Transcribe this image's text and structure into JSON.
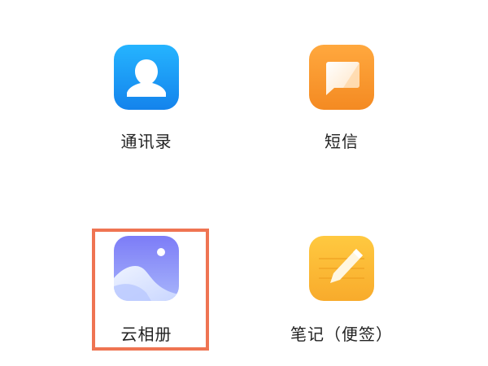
{
  "apps": [
    {
      "id": "contacts",
      "label": "通讯录",
      "icon": "contacts-icon"
    },
    {
      "id": "messages",
      "label": "短信",
      "icon": "message-icon"
    },
    {
      "id": "gallery",
      "label": "云相册",
      "icon": "gallery-icon"
    },
    {
      "id": "notes",
      "label": "笔记（便签）",
      "icon": "notes-icon"
    }
  ],
  "highlight": {
    "target": "gallery",
    "color": "#ef7452"
  },
  "colors": {
    "contacts_icon": "#1a9cf5",
    "messages_icon": "#f7962e",
    "gallery_icon": "#8c86f5",
    "notes_icon": "#fbb936"
  }
}
